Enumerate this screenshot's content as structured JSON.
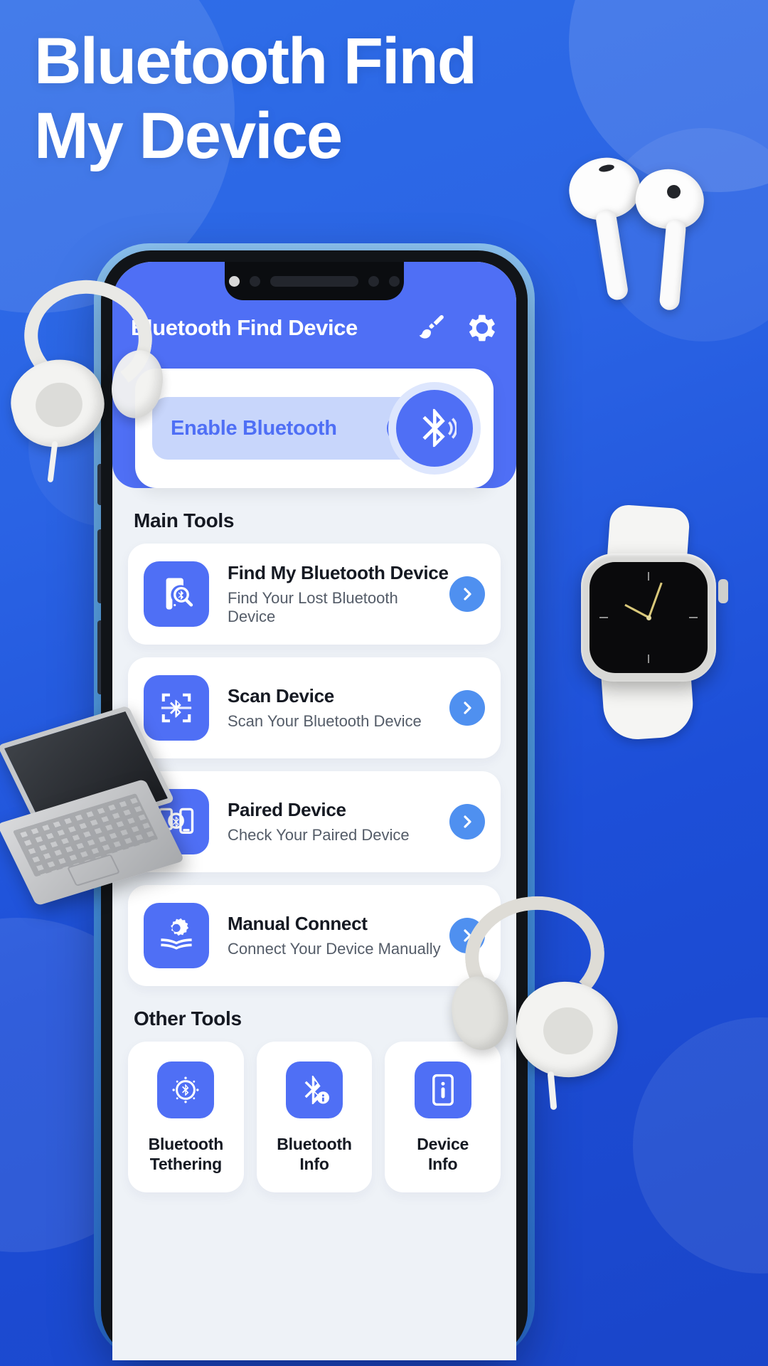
{
  "headline": {
    "line1": "Bluetooth Find",
    "line2": "My Device"
  },
  "colors": {
    "brand_blue": "#4f6ff5",
    "background_blue": "#2a63e4",
    "pill_blue": "#c8d6fb",
    "chevron_blue": "#4f90f0",
    "screen_bg": "#eef2f7",
    "title_dark": "#151922",
    "subtitle_gray": "#545c68"
  },
  "app": {
    "title": "Bluetooth Find Device",
    "header_icons": [
      {
        "name": "brush-icon",
        "label": "Theme"
      },
      {
        "name": "gear-icon",
        "label": "Settings"
      }
    ],
    "enable_card": {
      "label": "Enable Bluetooth",
      "toggle_state": "on",
      "bluetooth_icon": "bluetooth-signal-icon"
    },
    "main_tools_title": "Main Tools",
    "main_tools": [
      {
        "title": "Find My Bluetooth Device",
        "subtitle": "Find Your Lost Bluetooth Device",
        "icon": "phone-search-bluetooth-icon"
      },
      {
        "title": "Scan Device",
        "subtitle": "Scan Your Bluetooth Device",
        "icon": "scan-bluetooth-icon"
      },
      {
        "title": "Paired Device",
        "subtitle": "Check Your Paired Device",
        "icon": "paired-devices-icon"
      },
      {
        "title": "Manual Connect",
        "subtitle": "Connect Your Device Manually",
        "icon": "gear-book-icon"
      }
    ],
    "other_tools_title": "Other Tools",
    "other_tools": [
      {
        "label": "Bluetooth\nTethering",
        "line1": "Bluetooth",
        "line2": "Tethering",
        "icon": "bluetooth-tethering-icon"
      },
      {
        "label": "Bluetooth\nInfo",
        "line1": "Bluetooth",
        "line2": "Info",
        "icon": "bluetooth-info-icon"
      },
      {
        "label": "Device\nInfo",
        "line1": "Device",
        "line2": "Info",
        "icon": "device-info-icon"
      }
    ],
    "chevron_label": "Open"
  },
  "decorations": [
    {
      "name": "airpods-image"
    },
    {
      "name": "headphones-image-left"
    },
    {
      "name": "headphones-image-right"
    },
    {
      "name": "smartwatch-image"
    },
    {
      "name": "laptop-image"
    }
  ]
}
